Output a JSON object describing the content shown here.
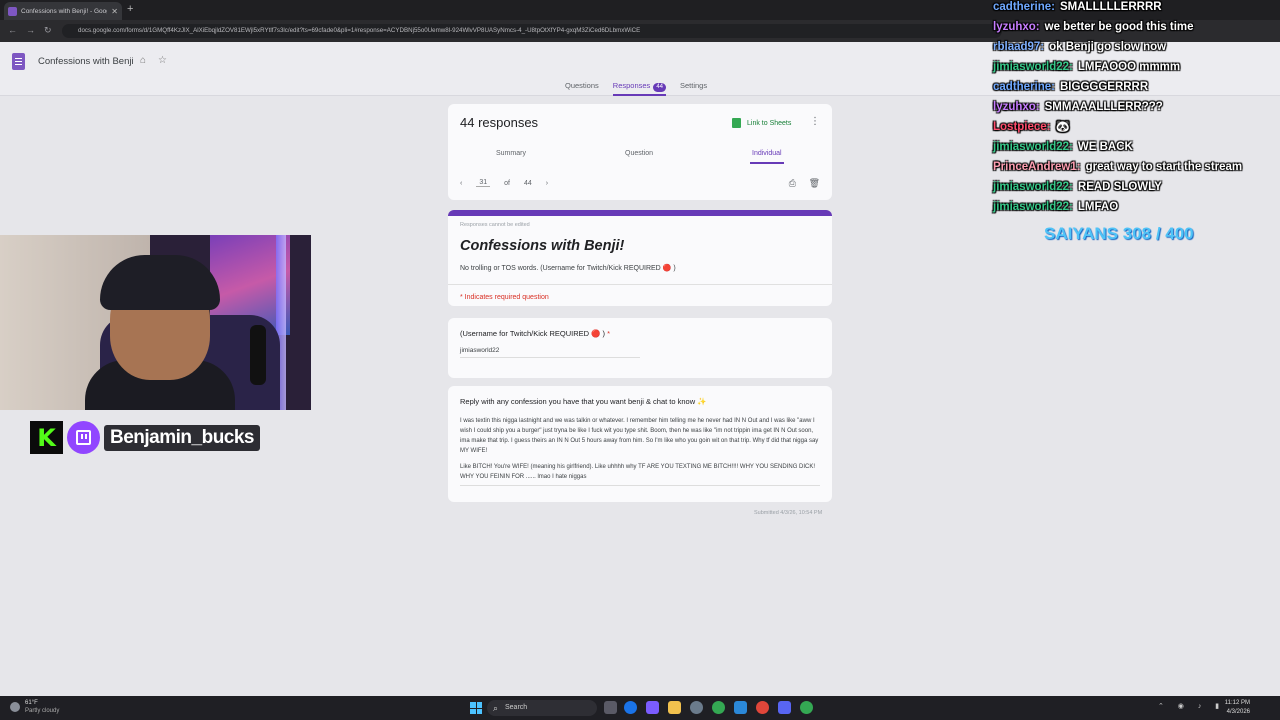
{
  "browser": {
    "tab_title": "Confessions with Benji! - Goog",
    "new_tab": "+",
    "url": "docs.google.com/forms/d/1GMQff4KzJlX_AlXiEbqjldZOV81EWjl5xRYtlf7s3lc/edit?ts=69cfade0&pli=1#response=ACYDBNj55o0Uemw8l-924WlvVP8UASyNmcs-4_-U8tpOtXfYP4-gxqM3ZiCed6DLbmxWiCE"
  },
  "forms": {
    "doc_title": "Confessions with Benji",
    "tabs": [
      "Questions",
      "Responses",
      "Settings"
    ],
    "response_badge": "44",
    "response_count": "44 responses",
    "link_to_sheets": "Link to Sheets",
    "subtabs": [
      "Summary",
      "Question",
      "Individual"
    ],
    "pager": {
      "current": "31",
      "of": "of",
      "total": "44"
    },
    "cannot_edit": "Responses cannot be edited",
    "form_title": "Confessions with Benji!",
    "form_desc": "No trolling or TOS words. (Username for Twitch/Kick REQUIRED 🔴 )",
    "required_note": "* Indicates required question",
    "q1": {
      "label": "(Username for Twitch/Kick REQUIRED 🔴 )",
      "star": "*",
      "answer": "jimiasworld22"
    },
    "q2": {
      "label": "Reply with any confession you have that you want benji & chat to know ✨",
      "answer_p1": "I was textin this nigga lastnight and we was talkin or whatever. I remember him telling me he never had IN N Out and I was like \"aww I wish I could ship you a burger\" just tryna be like I fuck wit you type shit. Boom, then he was like \"im not trippin ima get IN N Out soon, ima make that trip. I guess theirs an IN N Out 5 hours away from him. So I'm like who you goin wit on that trip. Why tf did that nigga say MY WIFE!",
      "answer_p2": "Like BITCH! You're WIFE! (meaning his girlfriend). Like uhhhh why TF ARE YOU TEXTING ME BITCH!!!! WHY YOU SENDING DICK! WHY YOU FEININ FOR ...... lmao I hate niggas"
    },
    "submitted": "Submitted 4/3/26, 10:54 PM"
  },
  "stream": {
    "streamer_name": "Benjamin_bucks",
    "kick_letter": "K",
    "goal_text": "SAIYANS 308 / 400"
  },
  "chat": [
    {
      "user": "cadtherine:",
      "text": "SMALLLLLERRRR",
      "color": "#6fa8ff"
    },
    {
      "user": "lyzuhxo:",
      "text": "we better be good this time",
      "color": "#c77dff"
    },
    {
      "user": "rblaad97:",
      "text": "ok Benji go slow now",
      "color": "#7fb0ff"
    },
    {
      "user": "jimiasworld22:",
      "text": "LMFAOOO mmmm",
      "color": "#37c98a"
    },
    {
      "user": "cadtherine:",
      "text": "BIGGGGERRRR",
      "color": "#6fa8ff"
    },
    {
      "user": "lyzuhxo:",
      "text": "SMMAAALLLERR???",
      "color": "#c77dff"
    },
    {
      "user": "Lostpiece:",
      "text": "🐼",
      "color": "#ff4d6d"
    },
    {
      "user": "jimiasworld22:",
      "text": "WE BACK",
      "color": "#37c98a"
    },
    {
      "user": "PrinceAndrew1:",
      "text": "great way to start the stream",
      "color": "#ff9fb2"
    },
    {
      "user": "jimiasworld22:",
      "text": "READ SLOWLY",
      "color": "#37c98a"
    },
    {
      "user": "jimiasworld22:",
      "text": "LMFAO",
      "color": "#37c98a"
    }
  ],
  "taskbar": {
    "weather_temp": "61°F",
    "weather_desc": "Partly cloudy",
    "search": "Search",
    "time": "11:12 PM",
    "date": "4/3/2026"
  }
}
